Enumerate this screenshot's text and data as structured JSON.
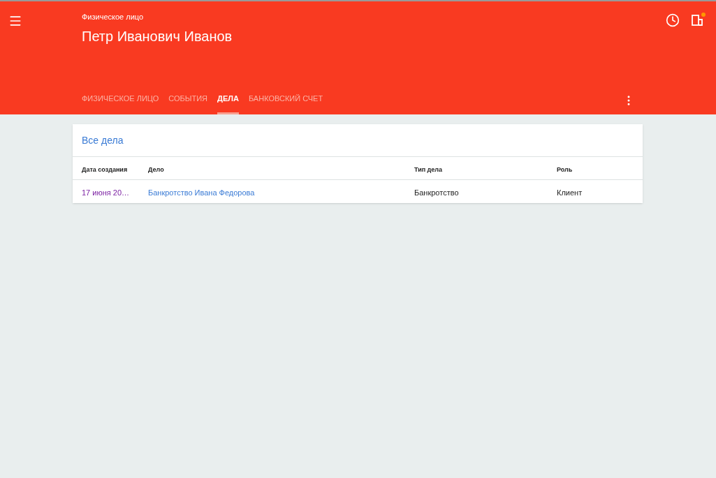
{
  "header": {
    "subtitle": "Физическое лицо",
    "title": "Петр Иванович Иванов",
    "actions": [
      {
        "kind": "history",
        "badge": false
      },
      {
        "kind": "panel",
        "badge": true
      }
    ]
  },
  "tabs": [
    {
      "label": "ФИЗИЧЕСКОЕ ЛИЦО",
      "selected": false
    },
    {
      "label": "СОБЫТИЯ",
      "selected": false
    },
    {
      "label": "ДЕЛА",
      "selected": true
    },
    {
      "label": "БАНКОВСКИЙ СЧЕТ",
      "selected": false
    }
  ],
  "card": {
    "title": "Все дела",
    "table": {
      "columns": [
        "Дата создания",
        "Дело",
        "Тип дела",
        "Роль"
      ],
      "rows": [
        {
          "cells": [
            {
              "text": "17 июня 20…",
              "kind": "visited-link"
            },
            {
              "text": "Банкротство Ивана Федорова",
              "kind": "link"
            },
            {
              "text": "Банкротство",
              "kind": "text"
            },
            {
              "text": "Клиент",
              "kind": "text"
            }
          ]
        }
      ]
    }
  }
}
